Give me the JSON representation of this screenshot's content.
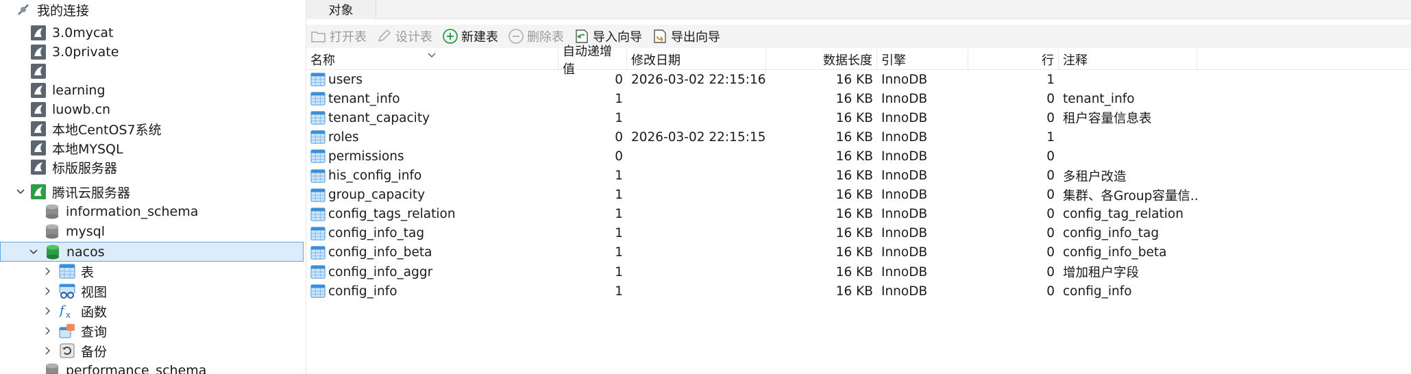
{
  "sidebar": {
    "root_label": "我的连接",
    "connections": [
      {
        "label": "3.0mycat"
      },
      {
        "label": "3.0private"
      },
      {
        "label": ""
      },
      {
        "label": "learning"
      },
      {
        "label": "luowb.cn"
      },
      {
        "label": "本地CentOS7系统"
      },
      {
        "label": "本地MYSQL"
      },
      {
        "label": "标版服务器"
      },
      {
        "label": "腾讯云服务器"
      }
    ],
    "databases": [
      {
        "label": "information_schema"
      },
      {
        "label": "mysql"
      },
      {
        "label": "nacos"
      }
    ],
    "nacos_children": [
      {
        "label": "表",
        "icon": "table-icon"
      },
      {
        "label": "视图",
        "icon": "view-icon"
      },
      {
        "label": "函数",
        "icon": "function-icon"
      },
      {
        "label": "查询",
        "icon": "query-icon"
      },
      {
        "label": "备份",
        "icon": "backup-icon"
      }
    ],
    "after": [
      {
        "label": "performance_schema"
      }
    ]
  },
  "tabs": {
    "objects": "对象"
  },
  "toolbar": {
    "open_table": "打开表",
    "design_table": "设计表",
    "new_table": "新建表",
    "delete_table": "删除表",
    "import_wizard": "导入向导",
    "export_wizard": "导出向导"
  },
  "table": {
    "headers": {
      "name": "名称",
      "auto_inc": "自动递增值",
      "modified": "修改日期",
      "data_length": "数据长度",
      "engine": "引擎",
      "rows": "行",
      "comment": "注释"
    },
    "rows": [
      {
        "name": "users",
        "auto_inc": "0",
        "modified": "2026-03-02 22:15:16",
        "data_length": "16 KB",
        "engine": "InnoDB",
        "rows": "1",
        "comment": ""
      },
      {
        "name": "tenant_info",
        "auto_inc": "1",
        "modified": "",
        "data_length": "16 KB",
        "engine": "InnoDB",
        "rows": "0",
        "comment": "tenant_info"
      },
      {
        "name": "tenant_capacity",
        "auto_inc": "1",
        "modified": "",
        "data_length": "16 KB",
        "engine": "InnoDB",
        "rows": "0",
        "comment": "租户容量信息表"
      },
      {
        "name": "roles",
        "auto_inc": "0",
        "modified": "2026-03-02 22:15:15",
        "data_length": "16 KB",
        "engine": "InnoDB",
        "rows": "1",
        "comment": ""
      },
      {
        "name": "permissions",
        "auto_inc": "0",
        "modified": "",
        "data_length": "16 KB",
        "engine": "InnoDB",
        "rows": "0",
        "comment": ""
      },
      {
        "name": "his_config_info",
        "auto_inc": "1",
        "modified": "",
        "data_length": "16 KB",
        "engine": "InnoDB",
        "rows": "0",
        "comment": "多租户改造"
      },
      {
        "name": "group_capacity",
        "auto_inc": "1",
        "modified": "",
        "data_length": "16 KB",
        "engine": "InnoDB",
        "rows": "0",
        "comment": "集群、各Group容量信..."
      },
      {
        "name": "config_tags_relation",
        "auto_inc": "1",
        "modified": "",
        "data_length": "16 KB",
        "engine": "InnoDB",
        "rows": "0",
        "comment": "config_tag_relation"
      },
      {
        "name": "config_info_tag",
        "auto_inc": "1",
        "modified": "",
        "data_length": "16 KB",
        "engine": "InnoDB",
        "rows": "0",
        "comment": "config_info_tag"
      },
      {
        "name": "config_info_beta",
        "auto_inc": "1",
        "modified": "",
        "data_length": "16 KB",
        "engine": "InnoDB",
        "rows": "0",
        "comment": "config_info_beta"
      },
      {
        "name": "config_info_aggr",
        "auto_inc": "1",
        "modified": "",
        "data_length": "16 KB",
        "engine": "InnoDB",
        "rows": "0",
        "comment": "增加租户字段"
      },
      {
        "name": "config_info",
        "auto_inc": "1",
        "modified": "",
        "data_length": "16 KB",
        "engine": "InnoDB",
        "rows": "0",
        "comment": "config_info"
      }
    ]
  }
}
